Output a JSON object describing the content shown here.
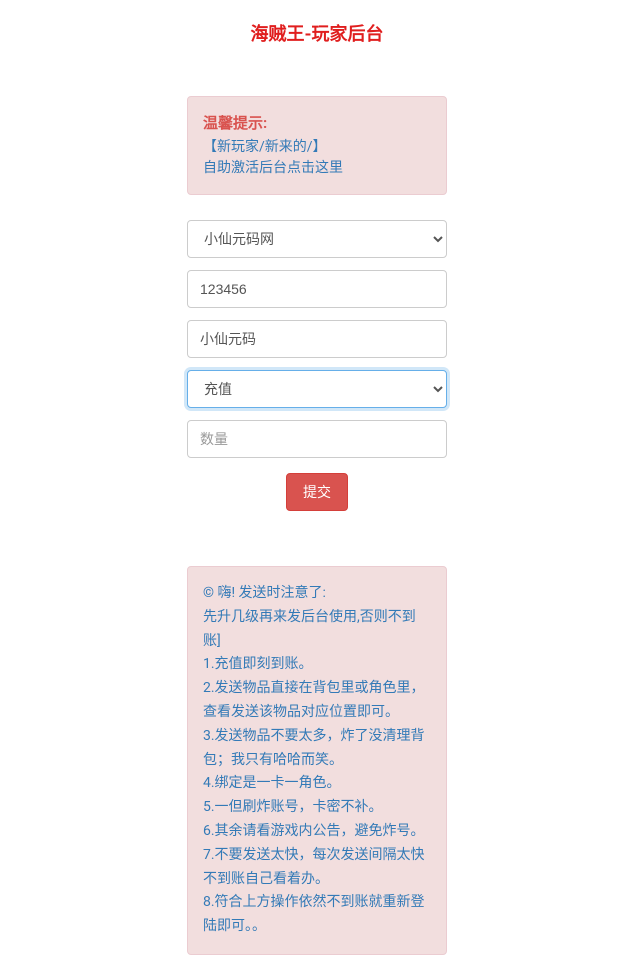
{
  "page_title": "海贼王-玩家后台",
  "tip_box": {
    "title": "温馨提示:",
    "line1": "【新玩家/新来的/】",
    "line2": "自助激活后台点击这里"
  },
  "form": {
    "server_select_value": "小仙元码网",
    "account_value": "123456",
    "character_value": "小仙元码",
    "action_select_value": "充值",
    "quantity_placeholder": "数量",
    "submit_label": "提交"
  },
  "notice": {
    "header": "© 嗨! 发送时注意了:",
    "intro": "先升几级再来发后台使用,否则不到账]",
    "item1": "1.充值即刻到账。",
    "item2": "2.发送物品直接在背包里或角色里，查看发送该物品对应位置即可。",
    "item3": "3.发送物品不要太多，炸了没清理背包；我只有哈哈而笑。",
    "item4": "4.绑定是一卡一角色。",
    "item5": "5.一但刷炸账号，卡密不补。",
    "item6": "6.其余请看游戏内公告，避免炸号。",
    "item7": "7.不要发送太快，每次发送间隔太快不到账自己看着办。",
    "item8": "8.符合上方操作依然不到账就重新登陆即可。。"
  }
}
